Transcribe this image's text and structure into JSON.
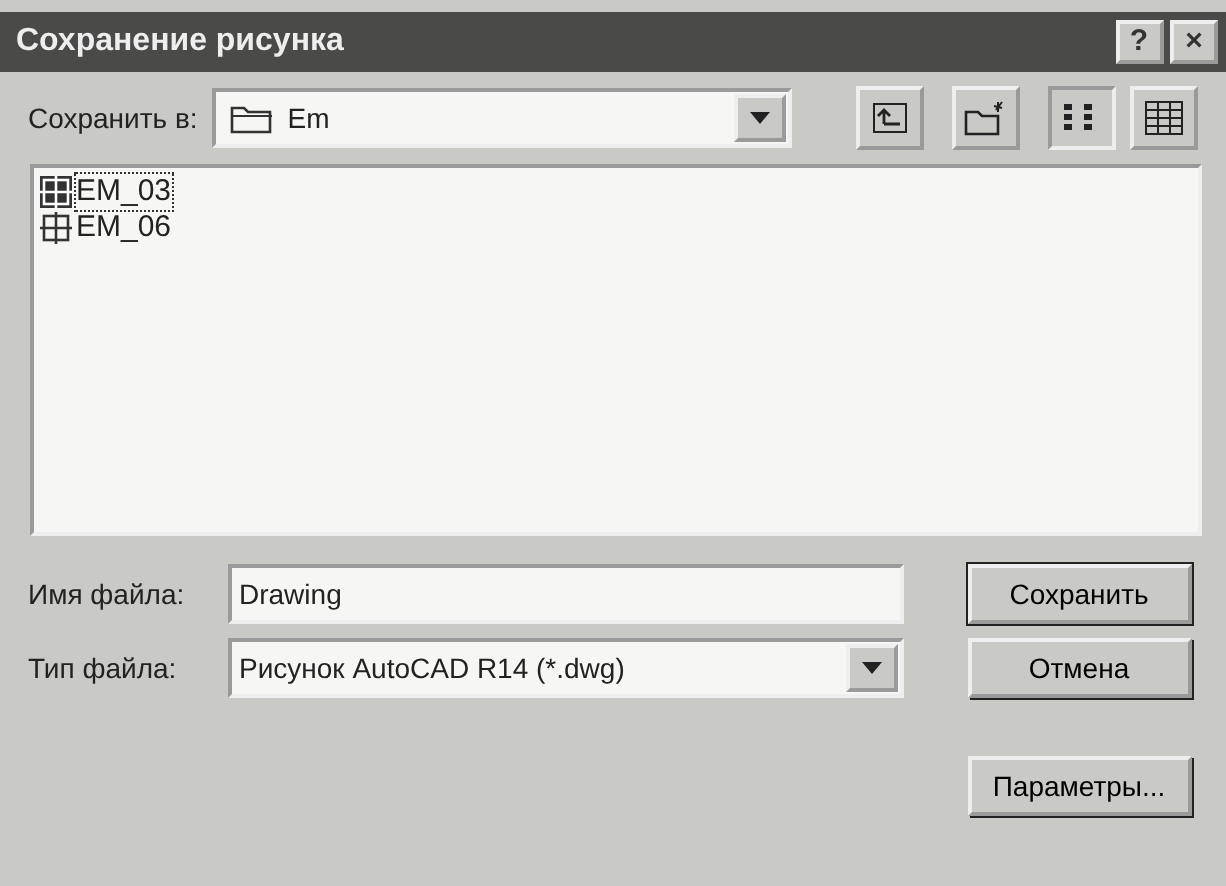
{
  "window": {
    "title": "Сохранение рисунка",
    "controls": [
      "?",
      "×"
    ]
  },
  "save_in": {
    "label": "Сохранить в:",
    "folder": "Em"
  },
  "files": [
    {
      "name": "EM_03",
      "selected": true
    },
    {
      "name": "EM_06",
      "selected": false
    }
  ],
  "file_name": {
    "label": "Имя файла:",
    "value": "Drawing"
  },
  "file_type": {
    "label": "Тип файла:",
    "value": "Рисунок AutoCAD R14 (*.dwg)"
  },
  "buttons": [
    "Сохранить",
    "Отмена",
    "Параметры..."
  ]
}
